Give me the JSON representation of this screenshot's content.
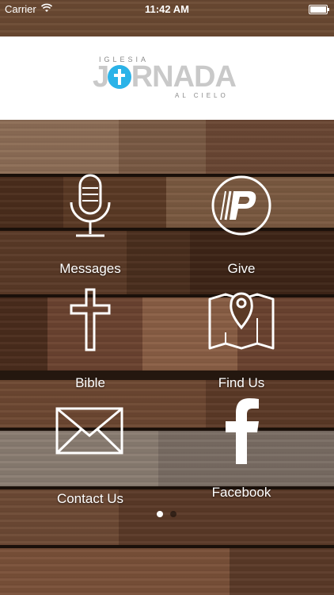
{
  "status_bar": {
    "carrier": "Carrier",
    "time": "11:42 AM"
  },
  "logo": {
    "top_text": "IGLESIA",
    "word": "JORNADA",
    "bottom_text": "AL CIELO",
    "accent": "#2bb3e8"
  },
  "tiles": [
    {
      "label": "Messages",
      "icon": "microphone-icon"
    },
    {
      "label": "Give",
      "icon": "pushpay-icon"
    },
    {
      "label": "Bible",
      "icon": "cross-icon"
    },
    {
      "label": "Find Us",
      "icon": "map-pin-icon"
    },
    {
      "label": "Contact Us",
      "icon": "envelope-icon"
    },
    {
      "label": "Facebook",
      "icon": "facebook-icon"
    }
  ],
  "pager": {
    "pages": 2,
    "current": 1
  }
}
